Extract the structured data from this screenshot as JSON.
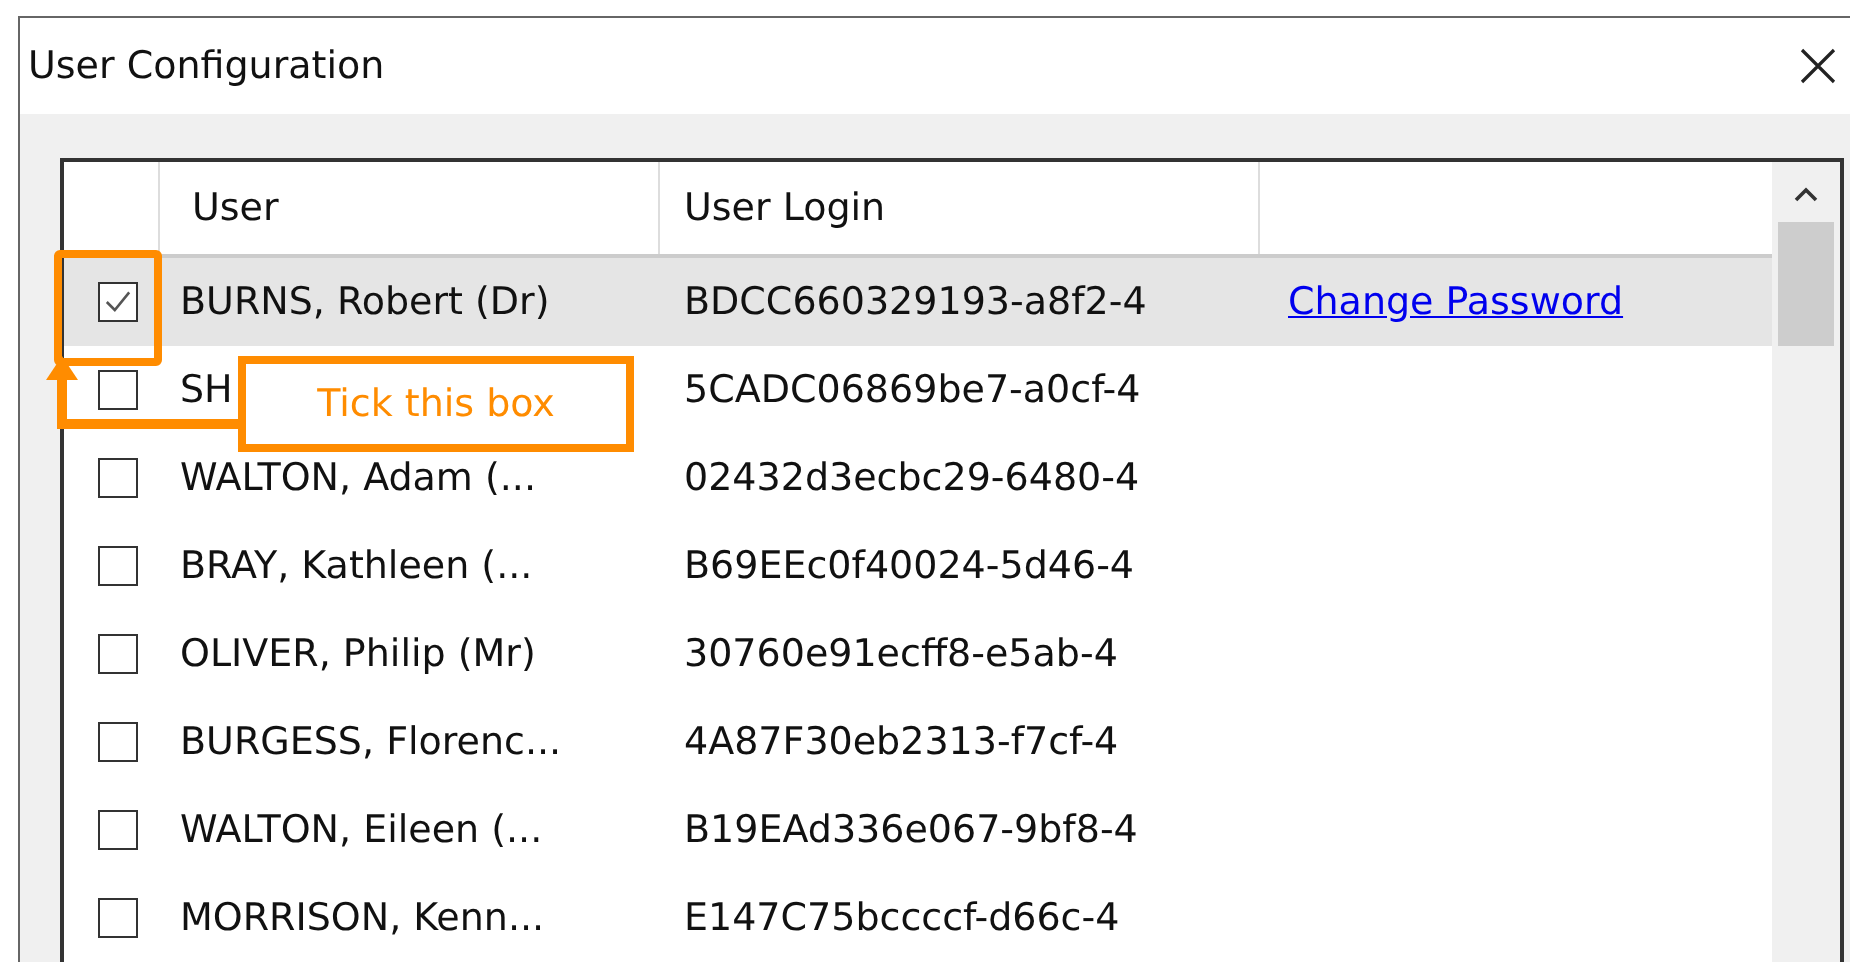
{
  "window": {
    "title": "User Configuration"
  },
  "table": {
    "columns": [
      "User",
      "User Login"
    ],
    "rows": [
      {
        "checked": true,
        "selected": true,
        "user": "BURNS, Robert (Dr)",
        "login": "BDCC660329193-a8f2-4",
        "action": "Change Password"
      },
      {
        "checked": false,
        "selected": false,
        "user": "SH",
        "login": "5CADC06869be7-a0cf-4"
      },
      {
        "checked": false,
        "selected": false,
        "user": "WALTON, Adam (...",
        "login": "02432d3ecbc29-6480-4"
      },
      {
        "checked": false,
        "selected": false,
        "user": "BRAY, Kathleen (...",
        "login": "B69EEc0f40024-5d46-4"
      },
      {
        "checked": false,
        "selected": false,
        "user": "OLIVER, Philip (Mr)",
        "login": "30760e91ecff8-e5ab-4"
      },
      {
        "checked": false,
        "selected": false,
        "user": "BURGESS, Florenc...",
        "login": "4A87F30eb2313-f7cf-4"
      },
      {
        "checked": false,
        "selected": false,
        "user": "WALTON, Eileen (...",
        "login": "B19EAd336e067-9bf8-4"
      },
      {
        "checked": false,
        "selected": false,
        "user": "MORRISON, Kenn...",
        "login": "E147C75bccccf-d66c-4"
      }
    ]
  },
  "callout": {
    "text": "Tick this box"
  }
}
